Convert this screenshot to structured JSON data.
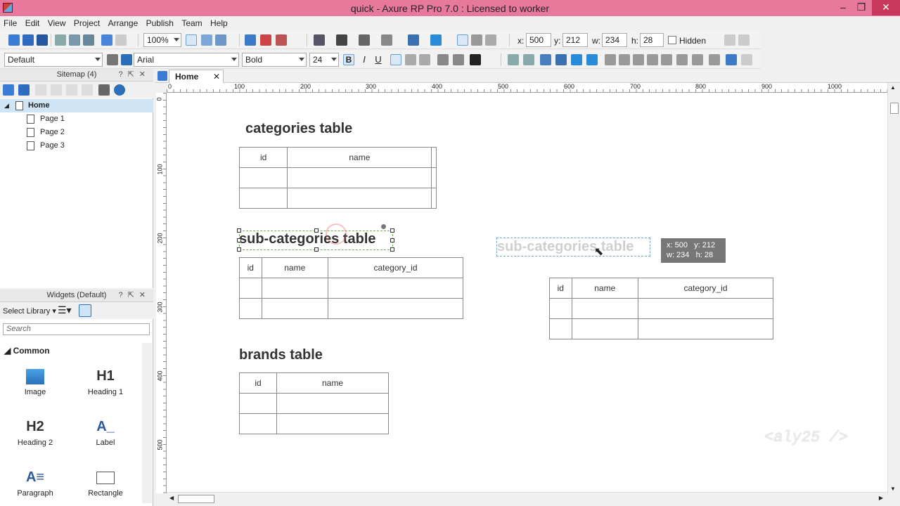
{
  "window": {
    "title": "quick - Axure RP Pro 7.0 : Licensed to worker"
  },
  "menu": [
    "File",
    "Edit",
    "View",
    "Project",
    "Arrange",
    "Publish",
    "Team",
    "Help"
  ],
  "toolbar": {
    "zoom": "100%",
    "x_label": "x:",
    "x_value": "500",
    "y_label": "y:",
    "y_value": "212",
    "w_label": "w:",
    "w_value": "234",
    "h_label": "h:",
    "h_value": "28",
    "hidden_label": "Hidden",
    "style": "Default",
    "font": "Arial",
    "weight": "Bold",
    "size": "24"
  },
  "sitemap": {
    "title": "Sitemap (4)",
    "pages": [
      {
        "label": "Home"
      },
      {
        "label": "Page 1"
      },
      {
        "label": "Page 2"
      },
      {
        "label": "Page 3"
      }
    ]
  },
  "widgets": {
    "title": "Widgets (Default)",
    "library_label": "Select Library",
    "search_placeholder": "Search",
    "section": "Common",
    "items": [
      {
        "label": "Image",
        "glyph": ""
      },
      {
        "label": "Heading 1",
        "glyph": "H1"
      },
      {
        "label": "Heading 2",
        "glyph": "H2"
      },
      {
        "label": "Label",
        "glyph": "A_"
      },
      {
        "label": "Paragraph",
        "glyph": "A≡"
      },
      {
        "label": "Rectangle",
        "glyph": ""
      }
    ]
  },
  "tab": {
    "label": "Home"
  },
  "ruler": {
    "h": [
      "0",
      "100",
      "200",
      "300",
      "400",
      "500",
      "600",
      "700",
      "800",
      "900",
      "1000"
    ],
    "v": [
      "0",
      "100",
      "200",
      "300",
      "400",
      "500"
    ]
  },
  "canvas": {
    "categories_title": "categories table",
    "categories_headers": [
      "id",
      "name",
      ""
    ],
    "subcategories_title": "sub-categories table",
    "subcategories_headers": [
      "id",
      "name",
      "category_id"
    ],
    "brands_title": "brands table",
    "brands_headers": [
      "id",
      "name"
    ],
    "ghost_title": "sub-categories table",
    "copy_headers": [
      "id",
      "name",
      "category_id"
    ],
    "tooltip": {
      "x": "x: 500",
      "y": "y: 212",
      "w": "w: 234",
      "h": "h: 28"
    },
    "watermark": "<aly25 />"
  }
}
